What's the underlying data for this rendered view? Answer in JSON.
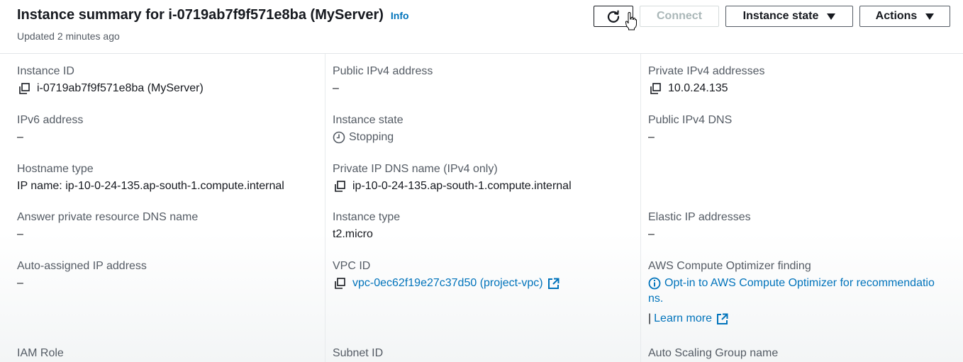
{
  "header": {
    "title": "Instance summary for i-0719ab7f9f571e8ba (MyServer)",
    "info": "Info",
    "updated": "Updated 2 minutes ago",
    "connect_label": "Connect",
    "instance_state_label": "Instance state",
    "actions_label": "Actions"
  },
  "fields": {
    "instance_id": {
      "label": "Instance ID",
      "value": "i-0719ab7f9f571e8ba (MyServer)"
    },
    "public_ipv4": {
      "label": "Public IPv4 address",
      "value": "–"
    },
    "private_ipv4": {
      "label": "Private IPv4 addresses",
      "value": "10.0.24.135"
    },
    "ipv6": {
      "label": "IPv6 address",
      "value": "–"
    },
    "instance_state": {
      "label": "Instance state",
      "value": "Stopping"
    },
    "public_dns": {
      "label": "Public IPv4 DNS",
      "value": "–"
    },
    "hostname_type": {
      "label": "Hostname type",
      "value": "IP name: ip-10-0-24-135.ap-south-1.compute.internal"
    },
    "private_dns": {
      "label": "Private IP DNS name (IPv4 only)",
      "value": "ip-10-0-24-135.ap-south-1.compute.internal"
    },
    "answer_dns": {
      "label": "Answer private resource DNS name",
      "value": "–"
    },
    "instance_type": {
      "label": "Instance type",
      "value": "t2.micro"
    },
    "elastic_ip": {
      "label": "Elastic IP addresses",
      "value": "–"
    },
    "auto_ip": {
      "label": "Auto-assigned IP address",
      "value": "–"
    },
    "vpc_id": {
      "label": "VPC ID",
      "value": "vpc-0ec62f19e27c37d50 (project-vpc)"
    },
    "optimizer": {
      "label": "AWS Compute Optimizer finding",
      "value_line1": "Opt-in to AWS Compute Optimizer for recommendatio",
      "value_line2": "ns.",
      "separator": "|",
      "learn_more": "Learn more"
    },
    "iam_role": {
      "label": "IAM Role"
    },
    "subnet_id": {
      "label": "Subnet ID"
    },
    "asg_name": {
      "label": "Auto Scaling Group name"
    }
  },
  "colors": {
    "link": "#0073bb",
    "text": "#16191f",
    "muted": "#545b64",
    "disabled": "#aab7b8"
  }
}
